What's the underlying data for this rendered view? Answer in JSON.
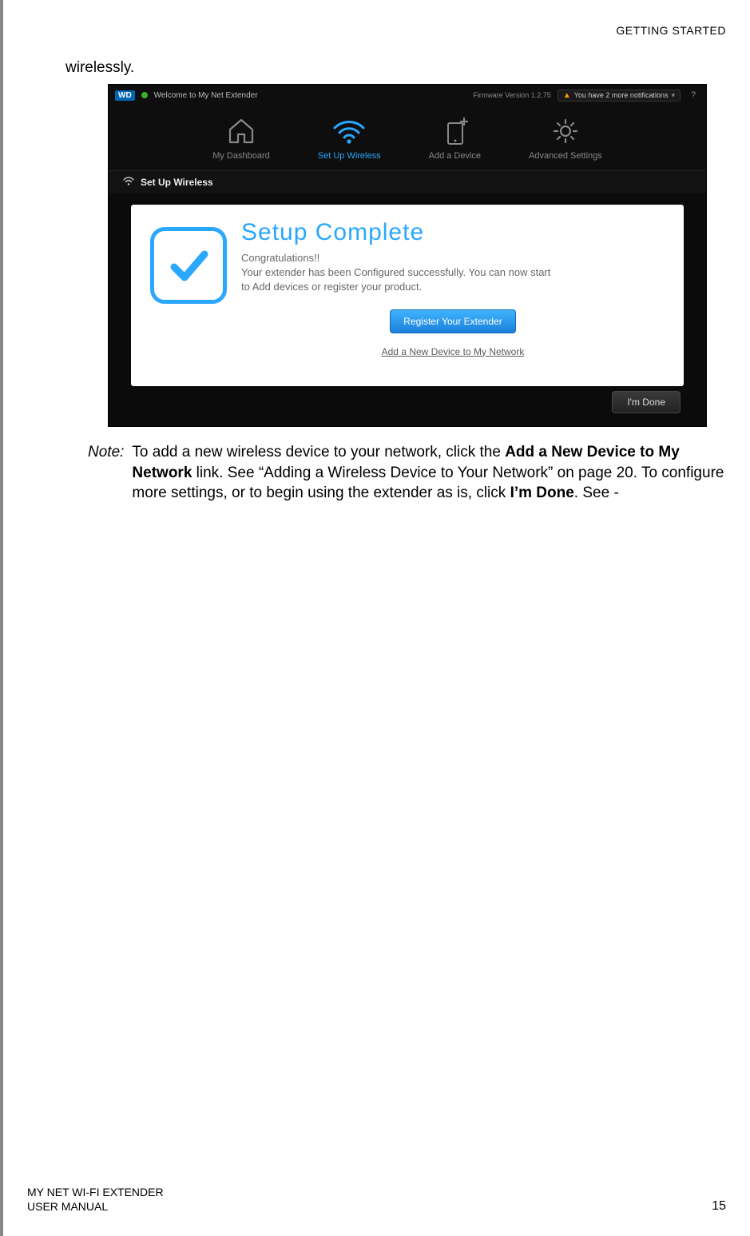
{
  "header": {
    "section": "GETTING STARTED"
  },
  "body": {
    "lead_text": "wirelessly."
  },
  "screenshot": {
    "brand_badge": "WD",
    "welcome_text": "Welcome to My Net Extender",
    "firmware_label": "Firmware Version 1.2.75",
    "notification_text": "You have 2 more notifications",
    "help_glyph": "?",
    "nav": {
      "dashboard": "My Dashboard",
      "wireless": "Set Up Wireless",
      "add_device": "Add a Device",
      "advanced": "Advanced Settings"
    },
    "section_title": "Set Up Wireless",
    "panel": {
      "title": "Setup  Complete",
      "line1": "Congratulations!!",
      "line2": "Your extender has been Configured successfully.  You can now start to Add devices or register your product.",
      "register_button": "Register Your  Extender",
      "add_link": "Add a New Device to My Network"
    },
    "done_button": "I'm Done"
  },
  "note": {
    "label": "Note:",
    "t1": "To add a new wireless device to your network, click the ",
    "b1": "Add a New Device to My Network",
    "t2": " link. See “Adding a Wireless Device to Your Network” on page 20. To configure more settings, or to begin using the extender as is, click ",
    "b2": "I’m Done",
    "t3": ". See -"
  },
  "footer": {
    "line1": "MY NET WI-FI EXTENDER",
    "line2": "USER MANUAL",
    "page": "15"
  }
}
